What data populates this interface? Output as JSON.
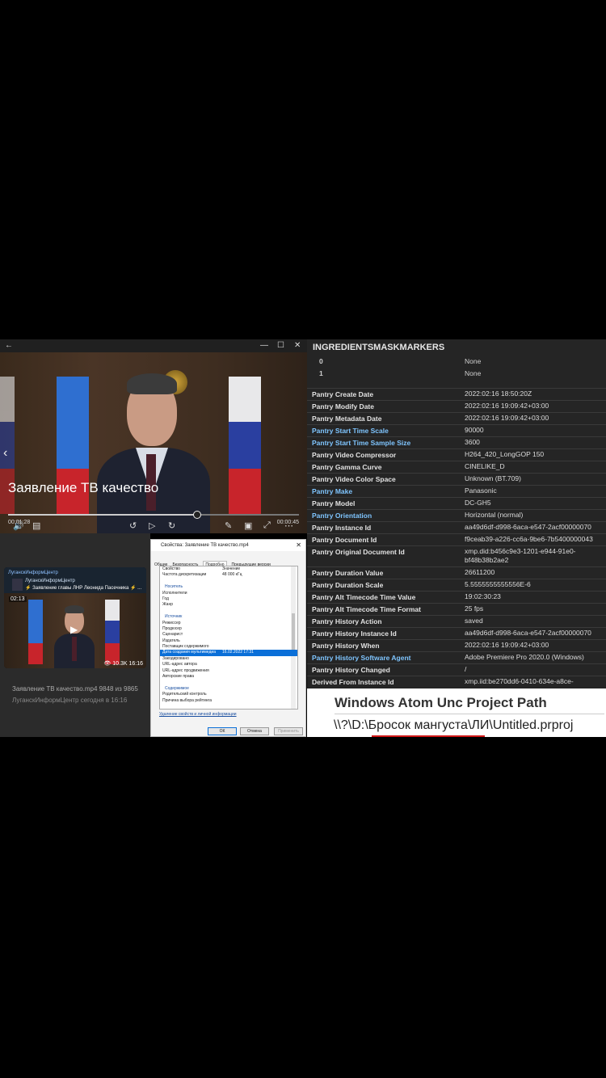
{
  "player": {
    "overlay_title": "Заявление ТВ качество",
    "time_elapsed": "00:01:28",
    "time_remaining": "00:00:45",
    "progress_fraction": 0.65,
    "window_buttons": [
      "—",
      "☐",
      "✕"
    ]
  },
  "telegram": {
    "channel_header": "ЛуганскИнформЦентр",
    "reply_channel": "ЛуганскИнформЦентр",
    "reply_text": "⚡ Заявление главы ЛНР Леонида Пасечника ⚡ ...",
    "duration": "02:13",
    "views": "10.3K",
    "time": "16:16",
    "file_line": "Заявление ТВ качество.mp4 9848 из 9865",
    "channel_line": "ЛуганскИнформЦентр   сегодня в 16:16"
  },
  "dialog": {
    "title": "Свойства: Заявление ТВ качество.mp4",
    "close": "✕",
    "tabs": [
      "Общие",
      "Безопасность",
      "Подробно",
      "Предыдущие версии"
    ],
    "active_tab": "Подробно",
    "rows": [
      {
        "k": "Свойство",
        "v": "Значение",
        "type": "hdr"
      },
      {
        "k": "Частота дискретизации",
        "v": "48 000 кГц",
        "type": ""
      },
      {
        "k": "",
        "v": "",
        "type": ""
      },
      {
        "k": "Носитель",
        "v": "",
        "type": "group"
      },
      {
        "k": "Исполнители",
        "v": "",
        "type": ""
      },
      {
        "k": "Год",
        "v": "",
        "type": ""
      },
      {
        "k": "Жанр",
        "v": "",
        "type": ""
      },
      {
        "k": "",
        "v": "",
        "type": ""
      },
      {
        "k": "Источник",
        "v": "",
        "type": "group"
      },
      {
        "k": "Режиссер",
        "v": "",
        "type": ""
      },
      {
        "k": "Продюсер",
        "v": "",
        "type": ""
      },
      {
        "k": "Сценарист",
        "v": "",
        "type": ""
      },
      {
        "k": "Издатель",
        "v": "",
        "type": ""
      },
      {
        "k": "Поставщик содержимого",
        "v": "",
        "type": ""
      },
      {
        "k": "Дата создания мультимедиа",
        "v": "16.02.2022 17:31",
        "type": "sel"
      },
      {
        "k": "Закодировано",
        "v": "",
        "type": ""
      },
      {
        "k": "URL-адрес автора",
        "v": "",
        "type": ""
      },
      {
        "k": "URL-адрес продвижения",
        "v": "",
        "type": ""
      },
      {
        "k": "Авторские права",
        "v": "",
        "type": ""
      },
      {
        "k": "",
        "v": "",
        "type": ""
      },
      {
        "k": "Содержимое",
        "v": "",
        "type": "group"
      },
      {
        "k": "Родительский контроль",
        "v": "",
        "type": ""
      },
      {
        "k": "Причина выбора рейтинга",
        "v": "",
        "type": ""
      }
    ],
    "remove_link": "Удаление свойств и личной информации",
    "ok": "ОК",
    "cancel": "Отмена",
    "apply": "Применить"
  },
  "meta": {
    "header": "INGREDIENTSMASKMARKERS",
    "sub_rows": [
      {
        "k": "0",
        "v": "None"
      },
      {
        "k": "1",
        "v": "None"
      }
    ],
    "rows": [
      {
        "k": "Pantry Create Date",
        "v": "2022:02:16 18:50:20Z",
        "hl": false
      },
      {
        "k": "Pantry Modify Date",
        "v": "2022:02:16 19:09:42+03:00",
        "hl": false
      },
      {
        "k": "Pantry Metadata Date",
        "v": "2022:02:16 19:09:42+03:00",
        "hl": false
      },
      {
        "k": "Pantry Start Time Scale",
        "v": "90000",
        "hl": true
      },
      {
        "k": "Pantry Start Time Sample Size",
        "v": "3600",
        "hl": true
      },
      {
        "k": "Pantry Video Compressor",
        "v": "H264_420_LongGOP 150",
        "hl": false
      },
      {
        "k": "Pantry Gamma Curve",
        "v": "CINELIKE_D",
        "hl": false
      },
      {
        "k": "Pantry Video Color Space",
        "v": "Unknown (BT.709)",
        "hl": false
      },
      {
        "k": "Pantry Make",
        "v": "Panasonic",
        "hl": true
      },
      {
        "k": "Pantry Model",
        "v": "DC-GH5",
        "hl": false
      },
      {
        "k": "Pantry Orientation",
        "v": "Horizontal (normal)",
        "hl": true
      },
      {
        "k": "Pantry Instance Id",
        "v": "aa49d6df-d998-6aca-e547-2acf00000070",
        "hl": false
      },
      {
        "k": "Pantry Document Id",
        "v": "f9ceab39-a226-cc6a-9be6-7b5400000043",
        "hl": false
      },
      {
        "k": "Pantry Original Document Id",
        "v": "xmp.did:b456c9e3-1201-e944-91e0-",
        "v2": "bf48b38b2ae2",
        "hl": false
      },
      {
        "k": "Pantry Duration Value",
        "v": "26611200",
        "hl": false
      },
      {
        "k": "Pantry Duration Scale",
        "v": "5.5555555555556E-6",
        "hl": false
      },
      {
        "k": "Pantry Alt Timecode Time Value",
        "v": "19:02:30:23",
        "hl": false
      },
      {
        "k": "Pantry Alt Timecode Time Format",
        "v": "25 fps",
        "hl": false
      },
      {
        "k": "Pantry History Action",
        "v": "saved",
        "hl": false
      },
      {
        "k": "Pantry History Instance Id",
        "v": "aa49d6df-d998-6aca-e547-2acf00000070",
        "hl": false
      },
      {
        "k": "Pantry History When",
        "v": "2022:02:16 19:09:42+03:00",
        "hl": false
      },
      {
        "k": "Pantry History Software Agent",
        "v": "Adobe Premiere Pro 2020.0 (Windows)",
        "hl": true
      },
      {
        "k": "Pantry History Changed",
        "v": "/",
        "hl": false
      },
      {
        "k": "Derived From Instance Id",
        "v": "xmp.iid:be270dd6-0410-634e-a8ce-",
        "hl": false
      }
    ]
  },
  "unc": {
    "title": "Windows Atom Unc Project Path",
    "path": "\\\\?\\D:\\Бросок мангуста\\ЛИ\\Untitled.prproj"
  },
  "colors": {
    "highlight_key": "#7fc5ff",
    "selection": "#0a6fd8",
    "underline": "#d01818"
  }
}
